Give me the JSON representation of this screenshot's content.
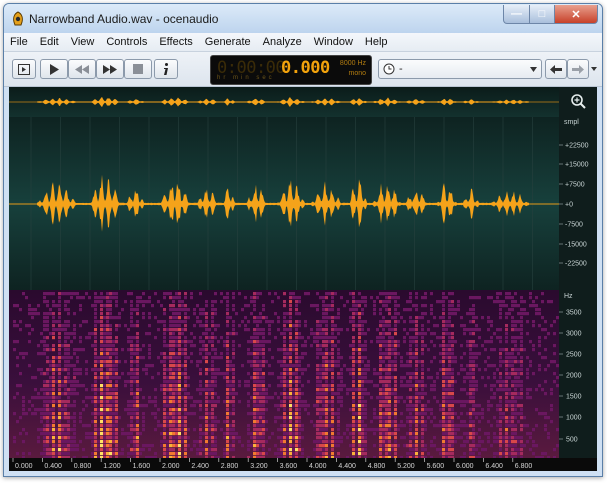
{
  "window": {
    "title": "Narrowband Audio.wav - ocenaudio",
    "app_icon": "ocenaudio-icon",
    "controls": [
      "minimize-icon",
      "maximize-icon",
      "close-icon"
    ]
  },
  "menu": [
    "File",
    "Edit",
    "View",
    "Controls",
    "Effects",
    "Generate",
    "Analyze",
    "Window",
    "Help"
  ],
  "toolbar": {
    "buttons": [
      "show-display-icon",
      "play-icon",
      "rewind-icon",
      "fast-forward-icon",
      "stop-icon",
      "info-icon"
    ],
    "time_placeholder": "0:00:00",
    "time": "0.000",
    "time_units": "hr   min  sec",
    "sample_rate": "8000 Hz",
    "channels": "mono",
    "history_value": "-",
    "nav_buttons": [
      "back-arrow-icon",
      "forward-arrow-icon",
      "menu-dropdown-icon"
    ]
  },
  "editor": {
    "zoom_icon": "zoom-in-icon",
    "amp_unit": "smpl",
    "amp_ticks": [
      "+22500",
      "+15000",
      "+7500",
      "+0",
      "-7500",
      "-15000",
      "-22500"
    ],
    "freq_unit": "Hz",
    "freq_ticks": [
      "3500",
      "3000",
      "2500",
      "2000",
      "1500",
      "1000",
      "500"
    ],
    "time_ticks": [
      "0.000",
      "0.400",
      "0.800",
      "1.200",
      "1.600",
      "2.000",
      "2.400",
      "2.800",
      "3.200",
      "3.600",
      "4.000",
      "4.400",
      "4.800",
      "5.200",
      "5.600",
      "6.000",
      "6.400",
      "6.800"
    ],
    "colors": {
      "waveform": "#f5a31a",
      "background": "#0f2a28",
      "grid": "#2c4a47",
      "spectrogram_low": "#2a0b33",
      "spectrogram_high": "#ffe066"
    }
  }
}
